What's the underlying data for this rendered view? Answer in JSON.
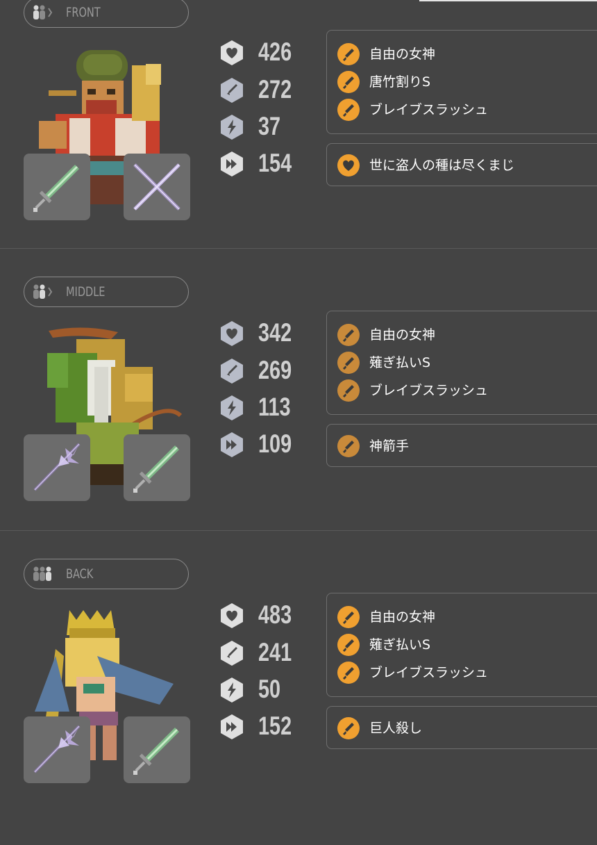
{
  "colors": {
    "background": "#444444",
    "skill_orange": "#f0a030",
    "skill_orange_muted": "#c98a3a",
    "stat_value": "#cfcfcf",
    "pill_border": "#8a8a8a",
    "slot_bg": "#6c6c6c"
  },
  "units": [
    {
      "position": "FRONT",
      "position_icon": "party-front-icon",
      "stats": {
        "hp": "426",
        "attack": "272",
        "skill": "37",
        "speed": "154"
      },
      "skills": [
        "自由の女神",
        "唐竹割りS",
        "ブレイブスラッシュ"
      ],
      "ability": "世に盗人の種は尽くまじ",
      "ability_icon": "heart-icon",
      "weapons": [
        "green-sword-icon",
        "purple-cross-blade-icon"
      ]
    },
    {
      "position": "MIDDLE",
      "position_icon": "party-middle-icon",
      "stats": {
        "hp": "342",
        "attack": "269",
        "skill": "113",
        "speed": "109"
      },
      "skills": [
        "自由の女神",
        "薙ぎ払いS",
        "ブレイブスラッシュ"
      ],
      "ability": "神箭手",
      "ability_icon": "sword-icon",
      "weapons": [
        "purple-halberd-icon",
        "green-sword-icon"
      ]
    },
    {
      "position": "BACK",
      "position_icon": "party-back-icon",
      "stats": {
        "hp": "483",
        "attack": "241",
        "skill": "50",
        "speed": "152"
      },
      "skills": [
        "自由の女神",
        "薙ぎ払いS",
        "ブレイブスラッシュ"
      ],
      "ability": "巨人殺し",
      "ability_icon": "sword-icon",
      "weapons": [
        "purple-halberd-icon",
        "green-sword-icon"
      ]
    }
  ]
}
